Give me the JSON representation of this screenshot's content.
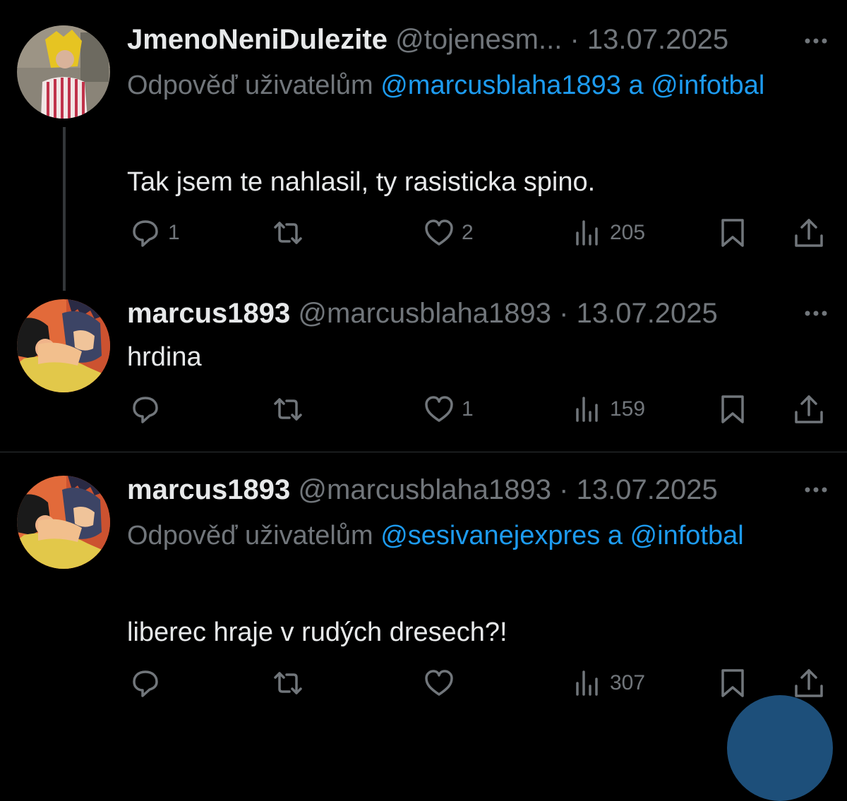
{
  "tweets": [
    {
      "name": "JmenoNeniDulezite",
      "handle": "@tojenesm...",
      "dot": "·",
      "date": "13.07.2025",
      "reply_prefix": "Odpověď uživatelům",
      "reply_mention1": "@marcusblaha1893",
      "reply_and": "a",
      "reply_mention2": "@infotbal",
      "text": "Tak jsem te nahlasil, ty rasisticka spino.",
      "replies": "1",
      "likes": "2",
      "views": "205"
    },
    {
      "name": "marcus1893",
      "handle": "@marcusblaha1893",
      "dot": "·",
      "date": "13.07.2025",
      "text": "hrdina",
      "replies": "",
      "likes": "1",
      "views": "159"
    },
    {
      "name": "marcus1893",
      "handle": "@marcusblaha1893",
      "dot": "·",
      "date": "13.07.2025",
      "reply_prefix": "Odpověď uživatelům",
      "reply_mention1": "@sesivanejexpres",
      "reply_and": "a",
      "reply_mention2": "@infotbal",
      "text": "liberec hraje v rudých dresech?!",
      "replies": "",
      "likes": "",
      "views": "307"
    }
  ],
  "icons": {
    "reply": "reply-bubble-icon",
    "retweet": "retweet-icon",
    "like": "heart-icon",
    "views": "views-bar-chart-icon",
    "bookmark": "bookmark-icon",
    "share": "share-icon",
    "more": "more-dots-icon"
  },
  "colors": {
    "background": "#000000",
    "text": "#e7e9ea",
    "muted": "#71767b",
    "mention": "#1d9bf0"
  }
}
